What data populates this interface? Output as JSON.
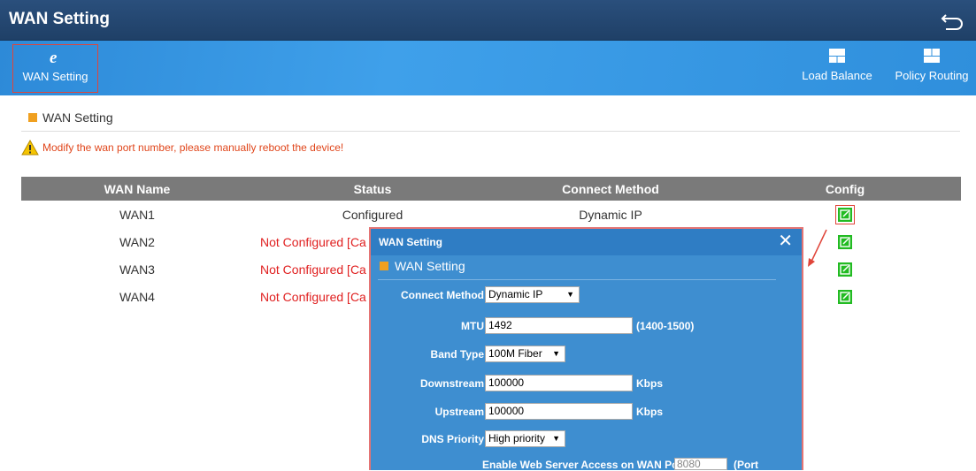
{
  "window": {
    "title": "WAN Setting"
  },
  "toolbar": {
    "wan_setting": "WAN Setting",
    "load_balance": "Load Balance",
    "policy_routing": "Policy Routing"
  },
  "section": {
    "title": "WAN Setting"
  },
  "warning": "Modify the wan port number, please manually reboot the device!",
  "table": {
    "headers": [
      "WAN Name",
      "Status",
      "Connect Method",
      "Config"
    ],
    "rows": [
      {
        "name": "WAN1",
        "status": "Configured",
        "method": "Dynamic IP"
      },
      {
        "name": "WAN2",
        "status": "Not Configured [Ca",
        "method": ""
      },
      {
        "name": "WAN3",
        "status": "Not Configured [Ca",
        "method": ""
      },
      {
        "name": "WAN4",
        "status": "Not Configured [Ca",
        "method": ""
      }
    ]
  },
  "dialog": {
    "title": "WAN Setting",
    "subtitle": "WAN Setting",
    "connect_method_label": "Connect Method",
    "connect_method_value": "Dynamic IP",
    "mtu_label": "MTU",
    "mtu_value": "1492",
    "mtu_range": "(1400-1500)",
    "band_type_label": "Band Type",
    "band_type_value": "100M Fiber",
    "downstream_label": "Downstream",
    "downstream_value": "100000",
    "downstream_unit": "Kbps",
    "upstream_label": "Upstream",
    "upstream_value": "100000",
    "upstream_unit": "Kbps",
    "dns_label": "DNS Priority",
    "dns_value": "High priority",
    "web_access_label": "Enable Web Server Access on WAN Port:",
    "web_access_port": "8080",
    "web_access_suffix": "(Port"
  },
  "colors": {
    "accent": "#3fa0ea",
    "warning": "#e0451a",
    "status_red": "#e02020",
    "config_green": "#22bb22"
  }
}
